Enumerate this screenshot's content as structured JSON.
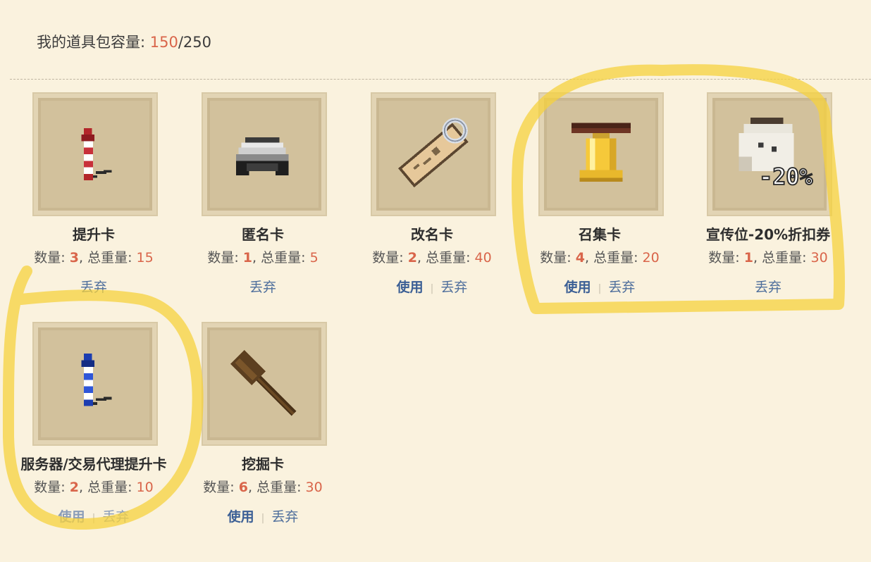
{
  "inventory": {
    "label": "我的道具包容量: ",
    "used": "150",
    "total": "/250"
  },
  "labels": {
    "qty": "数量: ",
    "sep_weight": ", 总重量: ",
    "use": "使用",
    "drop": "丢弃",
    "divider": "|"
  },
  "items": [
    {
      "name": "提升卡",
      "qty": "3",
      "weight": "15",
      "icon": "firework-red-icon",
      "usable": false
    },
    {
      "name": "匿名卡",
      "qty": "1",
      "weight": "5",
      "icon": "mask-icon",
      "usable": false
    },
    {
      "name": "改名卡",
      "qty": "2",
      "weight": "40",
      "icon": "name-tag-icon",
      "usable": true
    },
    {
      "name": "召集卡",
      "qty": "4",
      "weight": "20",
      "icon": "bell-icon",
      "usable": true
    },
    {
      "name": "宣传位-20%折扣券",
      "qty": "1",
      "weight": "30",
      "icon": "discount-coupon-icon",
      "discount_text": "-20%",
      "usable": false
    },
    {
      "name": "服务器/交易代理提升卡",
      "qty": "2",
      "weight": "10",
      "icon": "firework-blue-icon",
      "usable": true
    },
    {
      "name": "挖掘卡",
      "qty": "6",
      "weight": "30",
      "icon": "shovel-icon",
      "usable": true
    }
  ],
  "colors": {
    "background": "#faf2de",
    "accent": "#d9654a",
    "link": "#3b5f95",
    "highlight": "#f5d13d"
  }
}
